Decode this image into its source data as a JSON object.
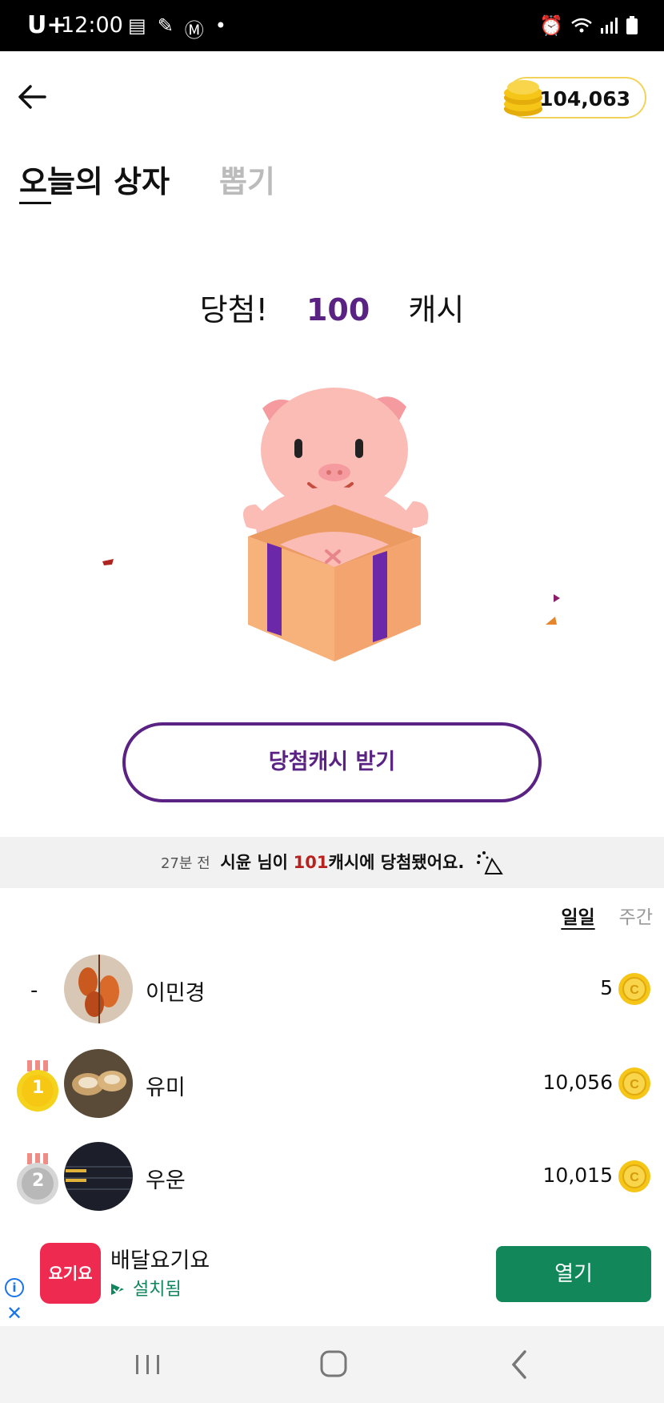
{
  "status_bar": {
    "carrier": "U+",
    "time": "12:00"
  },
  "header": {
    "cash_balance": "104,063"
  },
  "tabs": [
    {
      "label": "오늘의 상자",
      "active": true
    },
    {
      "label": "뽑기",
      "active": false
    }
  ],
  "result": {
    "prefix": "당첨!",
    "amount": "100",
    "unit": "캐시"
  },
  "claim_button": {
    "label": "당첨캐시 받기"
  },
  "winner_notice": {
    "ago": "27분 전",
    "name": "시윤 님이",
    "amount": "101",
    "suffix": "캐시에 당첨됐어요."
  },
  "period_tabs": {
    "daily": "일일",
    "weekly": "주간"
  },
  "ranking": [
    {
      "rank": "-",
      "name": "이민경",
      "score": "5"
    },
    {
      "rank": "1",
      "name": "유미",
      "score": "10,056"
    },
    {
      "rank": "2",
      "name": "우운",
      "score": "10,015"
    }
  ],
  "ad": {
    "logo_text": "요기요",
    "title": "배달요기요",
    "installed": "설치됨",
    "open_button": "열기"
  },
  "colors": {
    "accent_purple": "#5a2283",
    "gold": "#f5c518",
    "ad_green": "#12885a",
    "winner_red": "#b7221f"
  }
}
